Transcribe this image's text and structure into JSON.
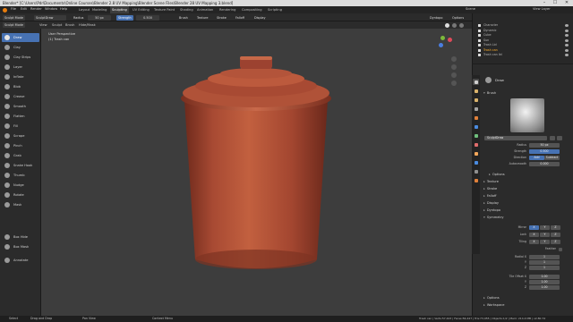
{
  "window": {
    "title": "Blender* [C:\\Users\\Pdr\\Documents\\Online Courses\\Blender 2.8 UV Mapping\\Blender Scene Files\\Blender 28 UV Mapping 3.blend]",
    "min": "–",
    "max": "☐",
    "close": "✕"
  },
  "menu": {
    "items": [
      "File",
      "Edit",
      "Render",
      "Window",
      "Help"
    ],
    "workspaces": [
      "Layout",
      "Modeling",
      "Sculpting",
      "UV Editing",
      "Texture Paint",
      "Shading",
      "Animation",
      "Rendering",
      "Compositing",
      "Scripting"
    ],
    "active_workspace": "Sculpting",
    "scene": "Scene",
    "view_layer": "View Layer"
  },
  "tool_header": {
    "mode": "Sculpt Mode",
    "brush": "SculptDraw",
    "radius_label": "Radius",
    "radius_value": "50 px",
    "strength_label": "Strength",
    "strength_value": "0.500",
    "brush_menu": "Brush",
    "texture_menu": "Texture",
    "stroke_menu": "Stroke",
    "falloff_menu": "Falloff",
    "display_menu": "Display",
    "dyntopo": "Dyntopo",
    "options": "Options"
  },
  "header2": {
    "items": [
      "Sculpt Mode",
      "View",
      "Sculpt",
      "Brush",
      "Hide/Mask"
    ]
  },
  "viewport": {
    "perspective": "User Perspective",
    "object": "(1) Trash can"
  },
  "tools": [
    "Draw",
    "Clay",
    "Clay Strips",
    "Layer",
    "Inflate",
    "Blob",
    "Crease",
    "Smooth",
    "Flatten",
    "Fill",
    "Scrape",
    "Pinch",
    "Grab",
    "Snake Hook",
    "Thumb",
    "Nudge",
    "Rotate",
    "Mask",
    "Box Hide",
    "Box Mask",
    "Annotate"
  ],
  "active_tool": "Draw",
  "outliner": {
    "rows": [
      "Character",
      "Dynamic",
      "Cube",
      "Sun",
      "Trash Lid",
      "Trash can",
      "Trash can lid"
    ],
    "selected": "Trash can"
  },
  "properties": {
    "tool_name": "Draw",
    "brush_section": "Brush",
    "brush_name": "SculptDraw",
    "radius_label": "Radius",
    "radius_value": "50 px",
    "strength_label": "Strength",
    "strength_value": "0.500",
    "direction_label": "Direction",
    "add": "Add",
    "subtract": "Subtract",
    "autosmooth_label": "Autosmooth",
    "autosmooth_value": "0.000",
    "sections": [
      "Options",
      "Texture",
      "Stroke",
      "Falloff",
      "Display",
      "Dyntopo",
      "Symmetry"
    ],
    "mirror_label": "Mirror",
    "lock_label": "Lock",
    "tiling_label": "Tiling",
    "feather_label": "Feather",
    "axes": [
      "X",
      "Y",
      "Z"
    ],
    "radial_label": "Radial X",
    "radial_values": [
      "1",
      "1",
      "1"
    ],
    "tile_offset_label": "Tile Offset X",
    "tile_offset_values": [
      "1.00",
      "1.00",
      "1.00"
    ],
    "bottom_sections": [
      "Options",
      "Workspace"
    ]
  },
  "statusbar": {
    "left": [
      "Select",
      "Drag and Drop",
      "Pan View",
      "Context Menu"
    ],
    "right": "Trash can | Verts:57,443 | Faces:56,447 | Tris:73,955 | Objects:1/2 | Mem: 214.4 MB | v2.80.74"
  },
  "colors": {
    "accent": "#4772b3",
    "object": "#a84a33",
    "selected_text": "#ffaf29"
  }
}
